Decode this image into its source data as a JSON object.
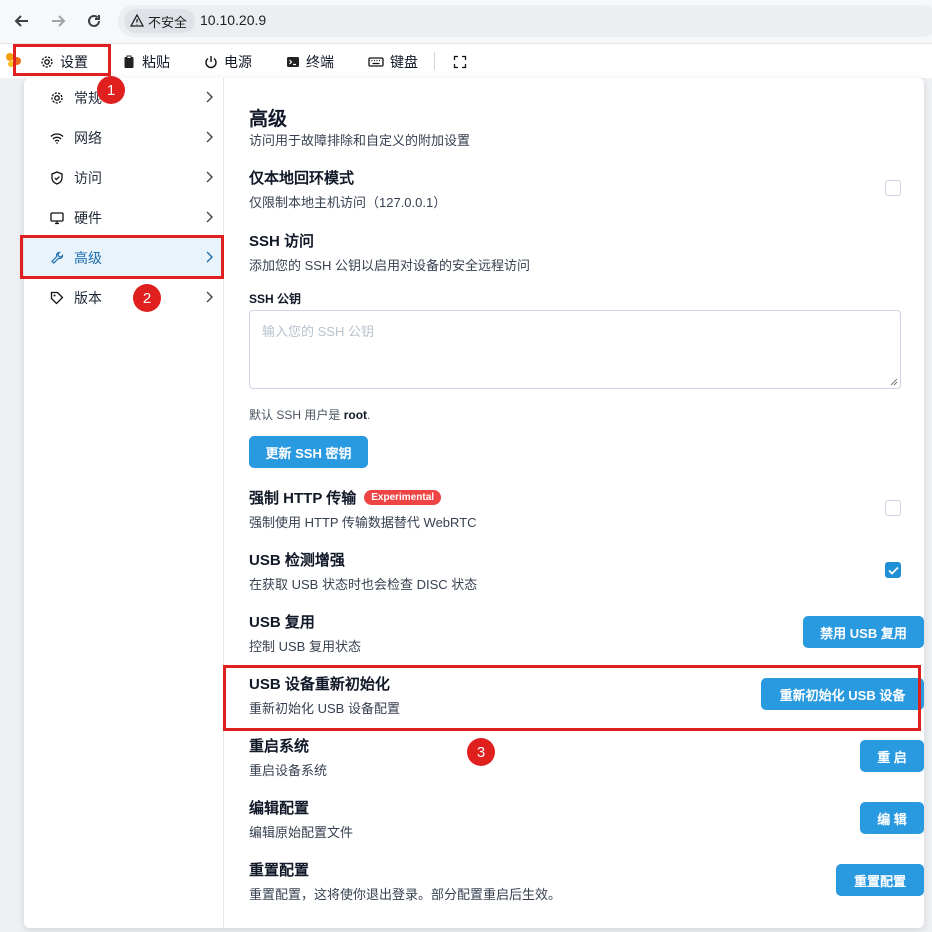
{
  "browser": {
    "security_label": "不安全",
    "url": "10.10.20.9"
  },
  "toolbar": {
    "settings": "设置",
    "paste": "粘贴",
    "power": "电源",
    "terminal": "终端",
    "keyboard": "键盘"
  },
  "sidebar": {
    "items": [
      {
        "label": "常规",
        "icon": "gear-icon"
      },
      {
        "label": "网络",
        "icon": "wifi-icon"
      },
      {
        "label": "访问",
        "icon": "shield-icon"
      },
      {
        "label": "硬件",
        "icon": "monitor-icon"
      },
      {
        "label": "高级",
        "icon": "wrench-icon"
      },
      {
        "label": "版本",
        "icon": "tag-icon"
      }
    ]
  },
  "content": {
    "title": "高级",
    "subtitle": "访问用于故障排除和自定义的附加设置",
    "loopback": {
      "title": "仅本地回环模式",
      "desc": "仅限制本地主机访问（127.0.0.1）",
      "checked": false
    },
    "ssh": {
      "title": "SSH 访问",
      "desc": "添加您的 SSH 公钥以启用对设备的安全远程访问",
      "field_label": "SSH 公钥",
      "placeholder": "输入您的 SSH 公钥",
      "hint_prefix": "默认 SSH 用户是 ",
      "hint_user": "root",
      "hint_suffix": ".",
      "button": "更新 SSH 密钥"
    },
    "http": {
      "title": "强制 HTTP 传输",
      "badge": "Experimental",
      "desc": "强制使用 HTTP 传输数据替代 WebRTC",
      "checked": false
    },
    "usb_detect": {
      "title": "USB 检测增强",
      "desc": "在获取 USB 状态时也会检查 DISC 状态",
      "checked": true
    },
    "usb_mux": {
      "title": "USB 复用",
      "desc": "控制 USB 复用状态",
      "button": "禁用 USB 复用"
    },
    "usb_reinit": {
      "title": "USB 设备重新初始化",
      "desc": "重新初始化 USB 设备配置",
      "button": "重新初始化 USB 设备"
    },
    "reboot": {
      "title": "重启系统",
      "desc": "重启设备系统",
      "button": "重 启"
    },
    "edit_config": {
      "title": "编辑配置",
      "desc": "编辑原始配置文件",
      "button": "编 辑"
    },
    "reset_config": {
      "title": "重置配置",
      "desc": "重置配置，这将使你退出登录。部分配置重启后生效。",
      "button": "重置配置"
    }
  },
  "annotations": {
    "step1": "1",
    "step2": "2",
    "step3": "3",
    "color": "#e01f1f"
  },
  "colors": {
    "accent": "#2a9ae0",
    "badge": "#ef4444"
  }
}
